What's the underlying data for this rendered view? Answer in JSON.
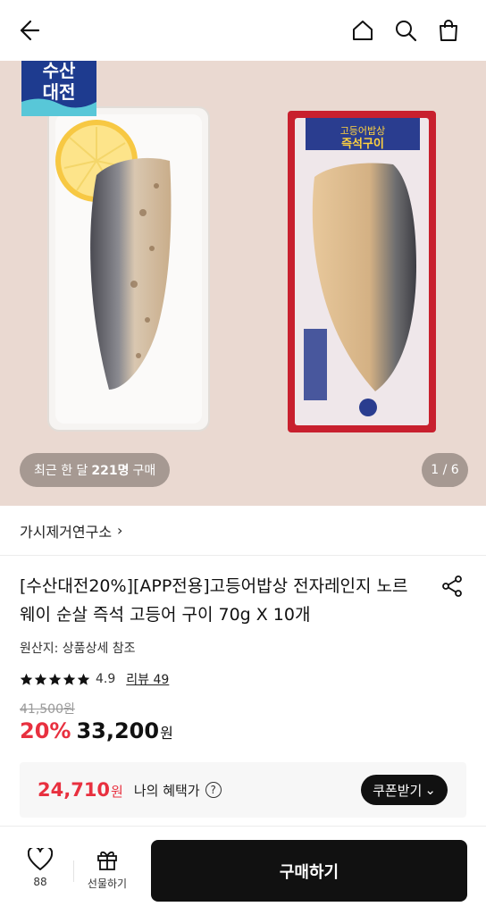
{
  "header": {
    "back_icon": "arrow-left-icon",
    "home_icon": "home-icon",
    "search_icon": "search-icon",
    "cart_icon": "shopping-bag-icon"
  },
  "hero": {
    "badge_line1": "수산",
    "badge_line2": "대전",
    "recent_prefix": "최근 한 달",
    "recent_count": "221명",
    "recent_suffix": "구매",
    "page_indicator": "1 / 6",
    "package_line1": "고등어밥상",
    "package_line2": "즉석구이"
  },
  "brand": {
    "name": "가시제거연구소",
    "chevron": "›"
  },
  "product": {
    "title": "[수산대전20%][APP전용]고등어밥상 전자레인지 노르웨이 순살 즉석 고등어 구이 70g X 10개",
    "origin": "원산지: 상품상세 참조",
    "rating": "4.9",
    "stars": 5,
    "review_link": "리뷰 49",
    "original_price": "41,500원",
    "discount": "20%",
    "price": "33,200",
    "price_unit": "원"
  },
  "benefit": {
    "price": "24,710",
    "price_unit": "원",
    "label": "나의 혜택가",
    "help_icon": "?",
    "coupon_button": "쿠폰받기",
    "coupon_chevron": "⌄"
  },
  "bottom_bar": {
    "like_count": "88",
    "gift_label": "선물하기",
    "buy_button": "구매하기"
  },
  "colors": {
    "accent_red": "#e8303f",
    "button_black": "#111111",
    "hero_bg": "#ead9d1"
  }
}
